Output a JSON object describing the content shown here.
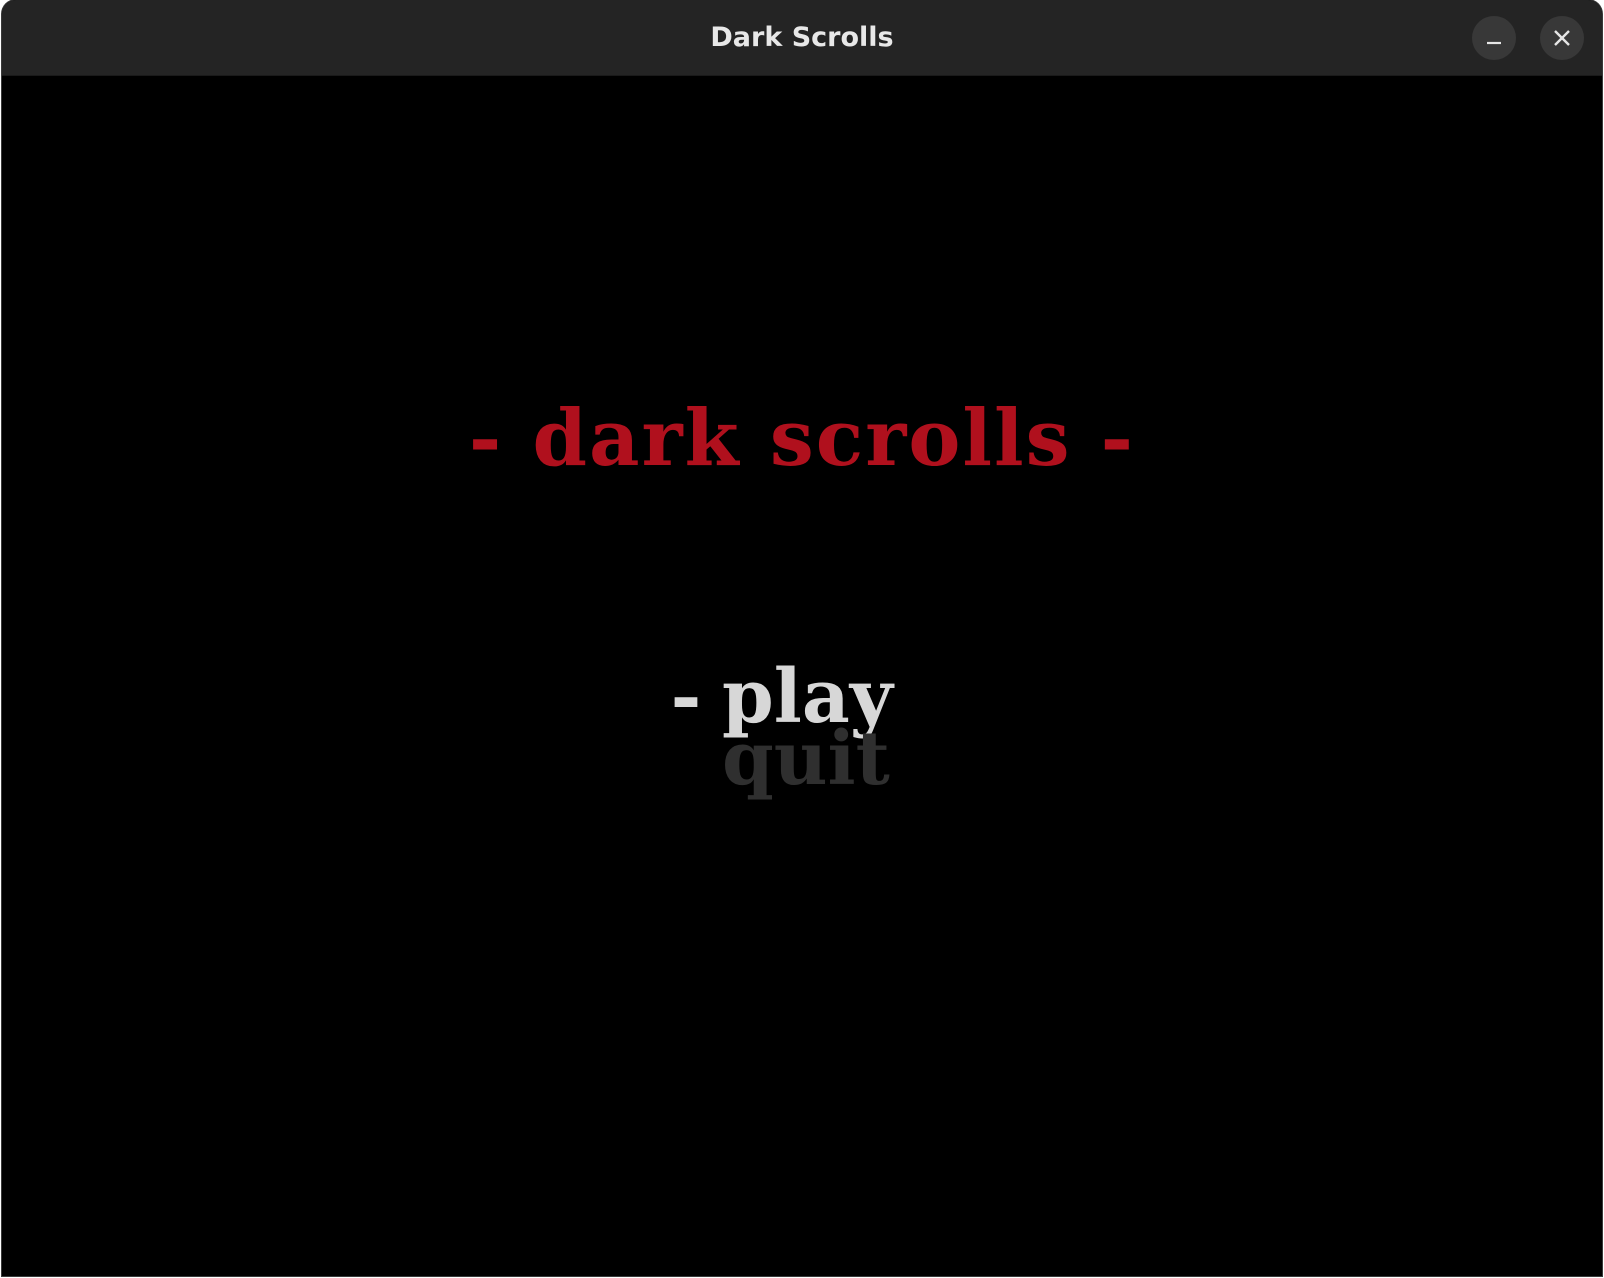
{
  "window": {
    "title": "Dark Scrolls",
    "minimize_icon": "minimize-icon",
    "close_icon": "close-icon"
  },
  "game": {
    "title": "- dark scrolls -",
    "title_color": "#b0101d",
    "menu": {
      "selected_marker": "-",
      "items": [
        {
          "label": "play",
          "selected": true,
          "color": "#d7d7d7"
        },
        {
          "label": "quit",
          "selected": false,
          "color": "#2f2f2f"
        }
      ]
    }
  }
}
